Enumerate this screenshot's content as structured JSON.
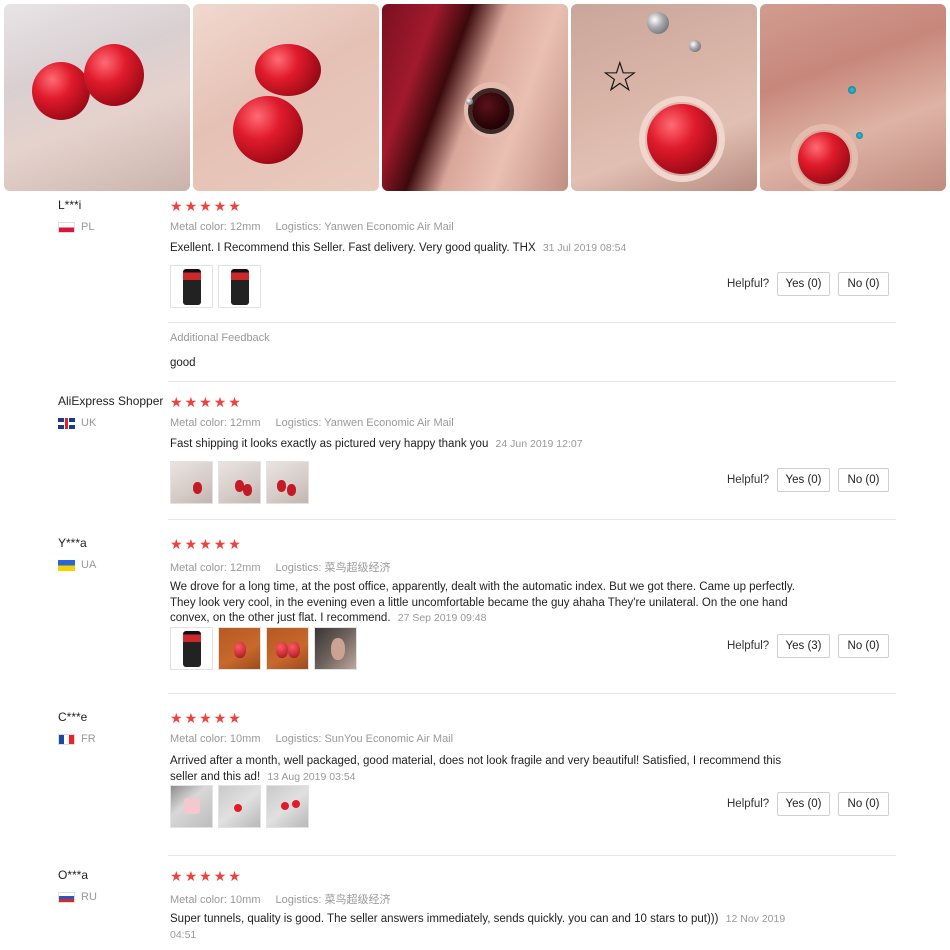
{
  "gallery": {
    "photos": [
      "product-hand-photo",
      "product-closeup-photo",
      "ear-dark-plug-photo",
      "ear-star-piercing-photo",
      "ear-red-plug-photo"
    ]
  },
  "ui": {
    "metal_color_label": "Metal color:",
    "logistics_label": "Logistics:",
    "helpful_label": "Helpful?",
    "star_color": "#f0413f"
  },
  "reviews": [
    {
      "user": "L***i",
      "country": "PL",
      "flag": "flag-pl",
      "rating": 5,
      "metal_color": "12mm",
      "logistics": "Yanwen Economic Air Mail",
      "text": "Exellent. I Recommend this Seller. Fast delivery. Very good quality. THX",
      "date": "31 Jul 2019 08:54",
      "yes": "Yes (0)",
      "no": "No (0)",
      "additional_label": "Additional Feedback",
      "additional_text": "good"
    },
    {
      "user": "AliExpress Shopper",
      "country": "UK",
      "flag": "flag-uk",
      "rating": 5,
      "metal_color": "12mm",
      "logistics": "Yanwen Economic Air Mail",
      "text": "Fast shipping it looks exactly as pictured very happy thank you",
      "date": "24 Jun 2019 12:07",
      "yes": "Yes (0)",
      "no": "No (0)"
    },
    {
      "user": "Y***a",
      "country": "UA",
      "flag": "flag-ua",
      "rating": 5,
      "metal_color": "12mm",
      "logistics": "菜鸟超级经济",
      "text": "We drove for a long time, at the post office, apparently, dealt with the automatic index. But we got there. Came up perfectly. They look very cool, in the evening even a little uncomfortable became the guy ahaha They're unilateral. On the one hand convex, on the other just flat. I recommend.",
      "date": "27 Sep 2019 09:48",
      "yes": "Yes (3)",
      "no": "No (0)"
    },
    {
      "user": "C***e",
      "country": "FR",
      "flag": "flag-fr",
      "rating": 5,
      "metal_color": "10mm",
      "logistics": "SunYou Economic Air Mail",
      "text": "Arrived after a month, well packaged, good material, does not look fragile and very beautiful! Satisfied, I recommend this seller and this ad!",
      "date": "13 Aug 2019 03:54",
      "yes": "Yes (0)",
      "no": "No (0)"
    },
    {
      "user": "O***a",
      "country": "RU",
      "flag": "flag-ru",
      "rating": 5,
      "metal_color": "10mm",
      "logistics": "菜鸟超级经济",
      "text": "Super tunnels, quality is good. The seller answers immediately, sends quickly. you can and 10 stars to put)))",
      "date": "12 Nov 2019 04:51"
    }
  ]
}
